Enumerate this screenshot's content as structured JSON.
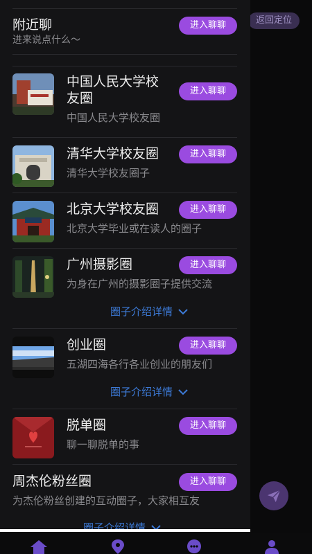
{
  "right_panel": {
    "return_label": "返回定位"
  },
  "nearby": {
    "title": "附近聊",
    "subtitle": "进来说点什么～",
    "button": "进入聊聊"
  },
  "groups": [
    {
      "title_line1": "中国人民大学校",
      "title_line2": "友圈",
      "desc": "中国人民大学校友圈",
      "button": "进入聊聊",
      "thumb_icon": "campus-gate-icon"
    },
    {
      "title": "清华大学校友圈",
      "desc": "清华大学校友圈子",
      "button": "进入聊聊",
      "thumb_icon": "tsinghua-gate-icon"
    },
    {
      "title": "北京大学校友圈",
      "desc": "北京大学毕业或在读人的圈子",
      "button": "进入聊聊",
      "thumb_icon": "peking-gate-icon"
    },
    {
      "title": "广州摄影圈",
      "desc": "为身在广州的摄影圈子提供交流",
      "button": "进入聊聊",
      "thumb_icon": "canton-tower-icon",
      "detail": "圈子介绍详情"
    },
    {
      "title": "创业圈",
      "desc": "五湖四海各行各业创业的朋友们",
      "button": "进入聊聊",
      "thumb_icon": "sky-road-icon",
      "detail": "圈子介绍详情"
    },
    {
      "title": "脱单圈",
      "desc": "聊一聊脱单的事",
      "button": "进入聊聊",
      "thumb_icon": "red-envelope-icon"
    },
    {
      "title": "周杰伦粉丝圈",
      "desc": "为杰伦粉丝创建的互动圈子，大家相互友",
      "button": "进入聊聊",
      "detail": "圈子介绍详情"
    }
  ],
  "colors": {
    "accent": "#9a4be0",
    "link": "#3d7bd8",
    "drawer_bg": "#141416"
  }
}
